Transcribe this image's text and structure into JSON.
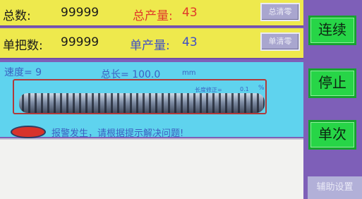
{
  "counters": {
    "total_label": "总数:",
    "total_value": "99999",
    "total_output_label": "总产量:",
    "total_output_value": "43",
    "total_clear": "总清零",
    "single_label": "单把数:",
    "single_value": "99999",
    "single_output_label": "单产量:",
    "single_output_value": "43",
    "single_clear": "单清零"
  },
  "status": {
    "speed_text": "速度= 9",
    "length_label": "总长= 100.0",
    "length_unit": "mm",
    "correction_label": "长度修正=",
    "correction_value": "0.1",
    "correction_unit": "%",
    "alarm_text": "报警发生，请根据提示解决问题!"
  },
  "message_area": {
    "text": ""
  },
  "side_buttons": {
    "continuous": "连续",
    "stop": "停止",
    "single": "单次",
    "aux_settings": "辅助设置"
  },
  "colors": {
    "yellow_panel": "#eee94d",
    "cyan_panel": "#5fd3ee",
    "purple_bg": "#7e5fb8",
    "green_button": "#27d547",
    "alarm_red": "#d8332b"
  }
}
